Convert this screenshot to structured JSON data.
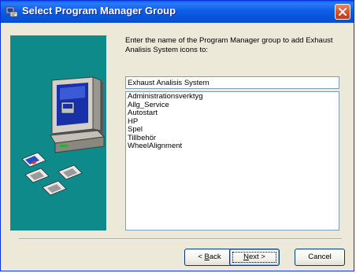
{
  "window": {
    "title": "Select Program Manager Group",
    "colors": {
      "titlebar": "#0653d8",
      "face": "#ece9d8",
      "art_background": "#0e8a8a",
      "close_button": "#d8532c"
    }
  },
  "content": {
    "prompt": "Enter the name of the Program Manager group to add Exhaust Analisis System icons to:",
    "group_name_value": "Exhaust Analisis System",
    "groups": [
      "Administrationsverktyg",
      "Allg_Service",
      "Autostart",
      "HP",
      "Spel",
      "Tillbehör",
      "WheelAlignment"
    ]
  },
  "buttons": {
    "back": {
      "prefix": "< ",
      "accel": "B",
      "rest": "ack"
    },
    "next": {
      "accel": "N",
      "rest": "ext >"
    },
    "cancel": "Cancel"
  },
  "icons": {
    "title": "setup-app-icon",
    "close": "close-icon",
    "art": "computer-installer-illustration"
  }
}
